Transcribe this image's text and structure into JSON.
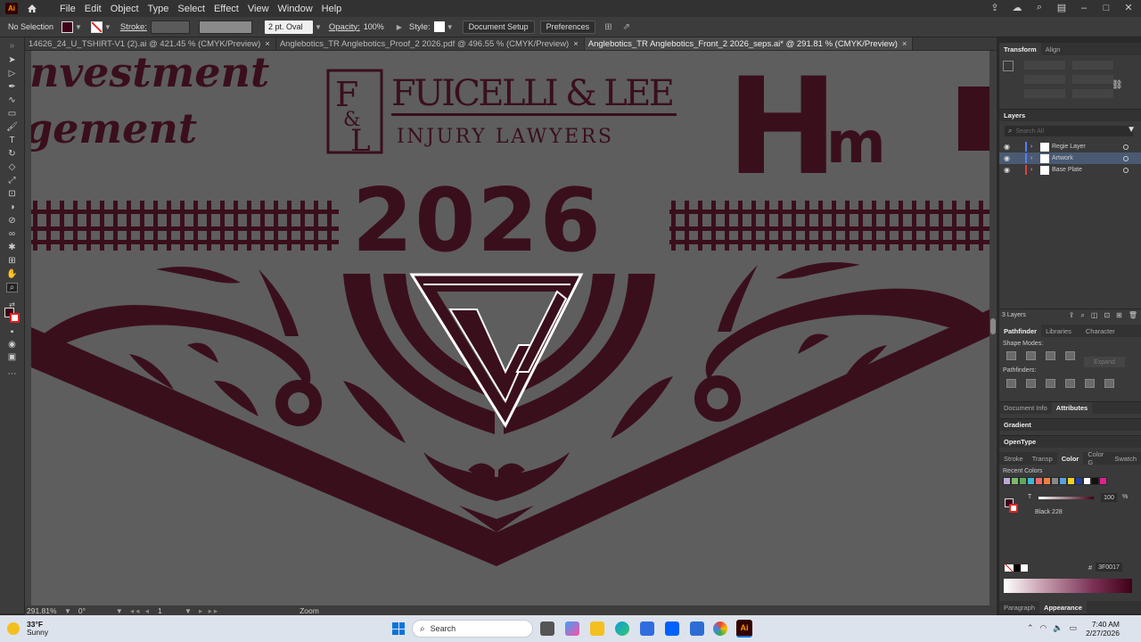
{
  "menubar": {
    "logo": "Ai",
    "items": [
      "File",
      "Edit",
      "Object",
      "Type",
      "Select",
      "Effect",
      "View",
      "Window",
      "Help"
    ]
  },
  "controlbar": {
    "selection": "No Selection",
    "stroke_label": "Stroke:",
    "brush": "2 pt. Oval",
    "opacity_label": "Opacity:",
    "opacity": "100%",
    "style_label": "Style:",
    "document_setup": "Document Setup",
    "preferences": "Preferences"
  },
  "tabs": [
    {
      "label": "14626_24_U_TSHIRT-V1 (2).ai @ 421.45 % (CMYK/Preview)",
      "active": false
    },
    {
      "label": "Anglebotics_TR Anglebotics_Proof_2 2026.pdf @ 496.55 % (CMYK/Preview)",
      "active": false
    },
    {
      "label": "Anglebotics_TR Anglebotics_Front_2 2026_seps.ai* @ 291.81 % (CMYK/Preview)",
      "active": true
    }
  ],
  "artwork": {
    "script_line1": "nvestment",
    "script_line2": "gement",
    "firm_initials_top": "F",
    "firm_initials_mid": "&",
    "firm_initials_bot": "L",
    "firm_name": "FUICELLI & LEE",
    "firm_tagline": "INJURY LAWYERS",
    "big_letters": "Hm",
    "year": "2026",
    "ink_color": "#3a0f1c"
  },
  "statusbar": {
    "zoom": "291.81%",
    "rotation": "0°",
    "page": "1",
    "mode": "Zoom"
  },
  "panels": {
    "transform_tab": "Transform",
    "align_tab": "Align",
    "layers_title": "Layers",
    "layers_search_placeholder": "Search All",
    "layers": [
      {
        "name": "Regie Layer",
        "color": "#4f7fff",
        "selected": false
      },
      {
        "name": "Artwork",
        "color": "#4f7fff",
        "selected": true
      },
      {
        "name": "Base Plate",
        "color": "#e04040",
        "selected": false
      }
    ],
    "layer_count": "3 Layers",
    "pathfinder_tabs": [
      "Pathfinder",
      "Libraries",
      "Character"
    ],
    "shape_modes": "Shape Modes:",
    "expand": "Expand",
    "pathfinders": "Pathfinders:",
    "docinfo_tab": "Document Info",
    "attributes_tab": "Attributes",
    "gradient": "Gradient",
    "opentype": "OpenType",
    "color_tabs": [
      "Stroke",
      "Transp",
      "Color",
      "Color G",
      "Swatch"
    ],
    "recent_colors": "Recent Colors",
    "recent_swatches": [
      "#b9a9d4",
      "#7db86d",
      "#5fa85a",
      "#3fb6d4",
      "#e96a6a",
      "#f08040",
      "#888888",
      "#5aa0e0",
      "#f0d020",
      "#2040a0",
      "#ffffff",
      "#111111",
      "#e02090"
    ],
    "tint_label": "T",
    "tint_value": "100",
    "tint_unit": "%",
    "swatch_name": "Black 228",
    "hex_label": "#",
    "hex_value": "3F0017",
    "bottom_tabs": [
      "Paragraph",
      "Appearance"
    ]
  },
  "taskbar": {
    "temp": "33°F",
    "weather": "Sunny",
    "search": "Search",
    "time": "7:40 AM",
    "date": "2/27/2026"
  }
}
